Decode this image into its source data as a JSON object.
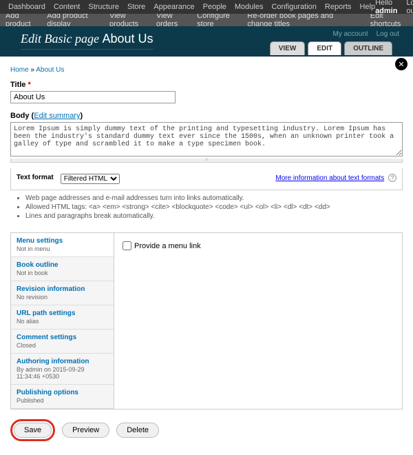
{
  "admin_menu": {
    "items": [
      "Dashboard",
      "Content",
      "Structure",
      "Store",
      "Appearance",
      "People",
      "Modules",
      "Configuration",
      "Reports",
      "Help"
    ],
    "hello": "Hello",
    "username": "admin",
    "logout": "Log out"
  },
  "shortcuts": {
    "items": [
      "Add product",
      "Add product display",
      "View products",
      "View orders",
      "Configure store",
      "Re-order book pages and change titles"
    ],
    "edit": "Edit shortcuts"
  },
  "account_links": {
    "my_account": "My account",
    "logout": "Log out"
  },
  "page_head": {
    "prefix": "Edit Basic page",
    "name": "About Us"
  },
  "tabs": {
    "view": "VIEW",
    "edit": "EDIT",
    "outline": "OUTLINE"
  },
  "breadcrumb": {
    "home": "Home",
    "current": "About Us"
  },
  "title": {
    "label": "Title",
    "value": "About Us"
  },
  "body": {
    "label": "Body",
    "summary_link": "Edit summary",
    "value": "Lorem Ipsum is simply dummy text of the printing and typesetting industry. Lorem Ipsum has been the industry's standard dummy text ever since the 1500s, when an unknown printer took a galley of type and scrambled it to make a type specimen book."
  },
  "text_format": {
    "label": "Text format",
    "selected": "Filtered HTML",
    "more_info": "More information about text formats",
    "tips": [
      "Web page addresses and e-mail addresses turn into links automatically.",
      "Allowed HTML tags: <a> <em> <strong> <cite> <blockquote> <code> <ul> <ol> <li> <dl> <dt> <dd>",
      "Lines and paragraphs break automatically."
    ]
  },
  "vtabs": [
    {
      "title": "Menu settings",
      "summary": "Not in menu"
    },
    {
      "title": "Book outline",
      "summary": "Not in book"
    },
    {
      "title": "Revision information",
      "summary": "No revision"
    },
    {
      "title": "URL path settings",
      "summary": "No alias"
    },
    {
      "title": "Comment settings",
      "summary": "Closed"
    },
    {
      "title": "Authoring information",
      "summary": "By admin on 2015-09-29 11:34:46 +0530"
    },
    {
      "title": "Publishing options",
      "summary": "Published"
    }
  ],
  "menu_link_label": "Provide a menu link",
  "buttons": {
    "save": "Save",
    "preview": "Preview",
    "delete": "Delete"
  }
}
